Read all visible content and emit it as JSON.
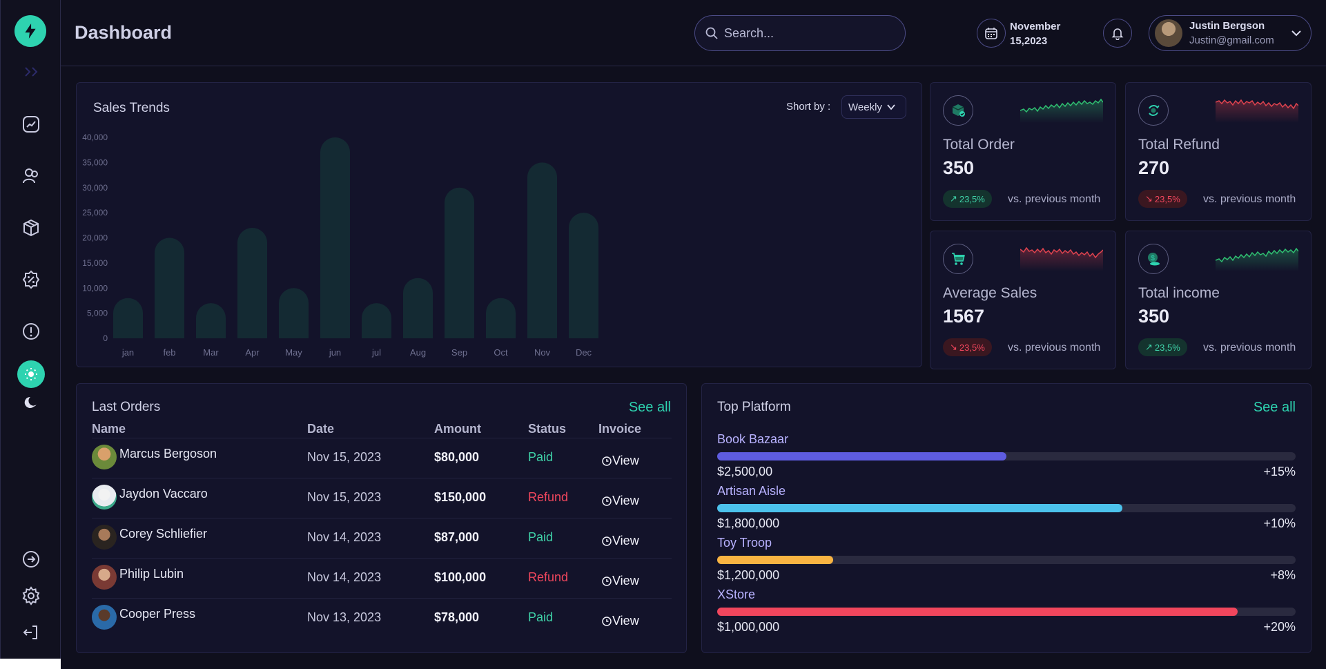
{
  "header": {
    "title": "Dashboard",
    "search_placeholder": "Search...",
    "date_line1": "November",
    "date_line2": "15,2023",
    "user_name": "Justin Bergson",
    "user_email": "Justin@gmail.com"
  },
  "sales": {
    "title": "Sales Trends",
    "sort_label": "Short by :",
    "sort_value": "Weekly"
  },
  "chart_data": {
    "type": "bar",
    "title": "Sales Trends",
    "categories": [
      "jan",
      "feb",
      "Mar",
      "Apr",
      "May",
      "jun",
      "jul",
      "Aug",
      "Sep",
      "Oct",
      "Nov",
      "Dec"
    ],
    "values": [
      8000,
      20000,
      7000,
      22000,
      10000,
      40000,
      7000,
      12000,
      30000,
      8000,
      35000,
      25000
    ],
    "yticks": [
      "0",
      "5,000",
      "10,000",
      "15,000",
      "20,000",
      "25,000",
      "30,000",
      "35,000",
      "40,000"
    ],
    "ylim": [
      0,
      40000
    ],
    "bar_color": "#142a33",
    "grid": false
  },
  "stats": [
    {
      "label": "Total Order",
      "value": "350",
      "change": "23,5%",
      "trend": "up",
      "note": "vs. previous month",
      "icon": "box-icon"
    },
    {
      "label": "Total Refund",
      "value": "270",
      "change": "23,5%",
      "trend": "down",
      "note": "vs. previous month",
      "icon": "refund-icon"
    },
    {
      "label": "Average Sales",
      "value": "1567",
      "change": "23,5%",
      "trend": "down",
      "note": "vs. previous month",
      "icon": "cart-icon"
    },
    {
      "label": "Total income",
      "value": "350",
      "change": "23,5%",
      "trend": "up",
      "note": "vs. previous month",
      "icon": "coin-icon"
    }
  ],
  "orders": {
    "title": "Last Orders",
    "see_all": "See all",
    "columns": [
      "Name",
      "Date",
      "Amount",
      "Status",
      "Invoice"
    ],
    "rows": [
      {
        "name": "Marcus Bergoson",
        "date": "Nov 15, 2023",
        "amount": "$80,000",
        "status": "Paid",
        "invoice": "View"
      },
      {
        "name": "Jaydon Vaccaro",
        "date": "Nov 15, 2023",
        "amount": "$150,000",
        "status": "Refund",
        "invoice": "View"
      },
      {
        "name": "Corey Schliefier",
        "date": "Nov 14, 2023",
        "amount": "$87,000",
        "status": "Paid",
        "invoice": "View"
      },
      {
        "name": "Philip Lubin",
        "date": "Nov 14, 2023",
        "amount": "$100,000",
        "status": "Refund",
        "invoice": "View"
      },
      {
        "name": "Cooper Press",
        "date": "Nov 13, 2023",
        "amount": "$78,000",
        "status": "Paid",
        "invoice": "View"
      }
    ]
  },
  "platform": {
    "title": "Top Platform",
    "see_all": "See all",
    "items": [
      {
        "name": "Book Bazaar",
        "amount": "$2,500,00",
        "percent": "+15%",
        "progress": 0.5,
        "color": "#5e5ce0"
      },
      {
        "name": "Artisan Aisle",
        "amount": "$1,800,000",
        "percent": "+10%",
        "progress": 0.7,
        "color": "#4cc2ec"
      },
      {
        "name": "Toy Troop",
        "amount": "$1,200,000",
        "percent": "+8%",
        "progress": 0.2,
        "color": "#f9b442"
      },
      {
        "name": "XStore",
        "amount": "$1,000,000",
        "percent": "+20%",
        "progress": 0.9,
        "color": "#f1465d"
      }
    ]
  },
  "colors": {
    "accent": "#2ed3b0",
    "paid": "#3fd2a8",
    "refund": "#f1465d"
  }
}
